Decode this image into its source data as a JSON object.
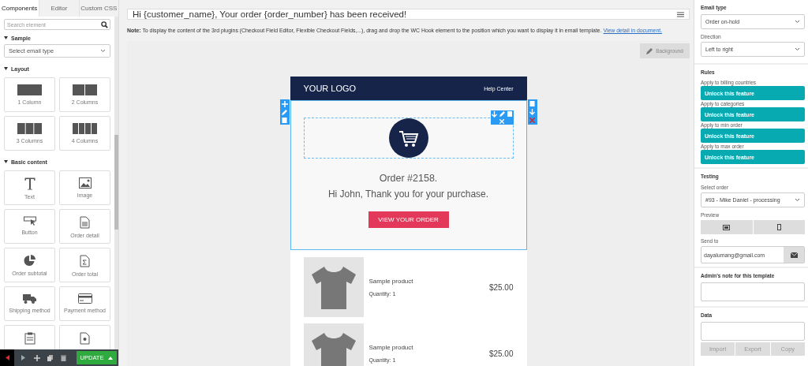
{
  "left_panel": {
    "tabs": [
      {
        "label": "Components",
        "selected": true
      },
      {
        "label": "Editor",
        "selected": false
      },
      {
        "label": "Custom CSS",
        "selected": false
      }
    ],
    "search": {
      "placeholder": "Search element"
    },
    "sections": [
      {
        "title": "Sample",
        "select": "Select email type"
      },
      {
        "title": "Layout",
        "tiles": [
          {
            "kind": "col1",
            "label": "1 Column"
          },
          {
            "kind": "col2",
            "label": "2 Columns"
          },
          {
            "kind": "col3",
            "label": "3 Columns"
          },
          {
            "kind": "col4",
            "label": "4 Columns"
          }
        ]
      },
      {
        "title": "Basic content",
        "tiles": [
          {
            "kind": "text",
            "label": "Text"
          },
          {
            "kind": "image",
            "label": "Image"
          },
          {
            "kind": "button",
            "label": "Button"
          },
          {
            "kind": "detail",
            "label": "Order detail"
          },
          {
            "kind": "subtotal",
            "label": "Order subtotal"
          },
          {
            "kind": "total",
            "label": "Order total"
          },
          {
            "kind": "truck",
            "label": "Shipping method"
          },
          {
            "kind": "card",
            "label": "Payment method"
          },
          {
            "kind": "clipboard"
          },
          {
            "kind": "file"
          }
        ]
      }
    ]
  },
  "bottom_bar": {
    "update": "UPDATE"
  },
  "editor": {
    "subject": "Hi {customer_name}, Your order {order_number} has been received!",
    "note": "**Note:** To display the content of the 3rd plugins (Checkout Field Editor, Flexible Checkout Fields,...), drag and drop the WC Hook element to the position which you want to display it in email template.",
    "note_link": "View detail in document.",
    "background_button": "Background",
    "email": {
      "logo": "YOUR LOGO",
      "help": "Help Center",
      "order": "Order #2158.",
      "greeting": "Hi John, Thank you for your purchase.",
      "button": "VIEW YOUR ORDER",
      "products": [
        {
          "name": "Sample product",
          "quantity": "Quantity: 1",
          "price": "$25.00"
        },
        {
          "name": "Sample product",
          "quantity": "Quantity: 1",
          "price": "$25.00"
        }
      ]
    }
  },
  "right_panel": {
    "email_type": {
      "label": "Email type",
      "value": "Order on-hold"
    },
    "direction": {
      "label": "Direction",
      "value": "Left to right"
    },
    "rules": {
      "title": "Rules",
      "items": [
        {
          "label": "Apply to billing countries",
          "button": "Unlock this feature"
        },
        {
          "label": "Apply to categories",
          "button": "Unlock this feature"
        },
        {
          "label": "Apply to min order",
          "button": "Unlock this feature"
        },
        {
          "label": "Apply to max order",
          "button": "Unlock this feature"
        }
      ]
    },
    "testing": {
      "title": "Testing",
      "order_label": "Select order",
      "order": "#93 - Mike Daniel - processing",
      "preview_label": "Preview",
      "send_label": "Send to",
      "send_value": "dayalumang@gmail.com"
    },
    "admin_note": {
      "title": "Admin's note for this template"
    },
    "data": {
      "title": "Data",
      "buttons": [
        {
          "label": "Import",
          "disabled": true
        },
        {
          "label": "Export",
          "disabled": true
        },
        {
          "label": "Copy",
          "disabled": true
        }
      ]
    }
  }
}
